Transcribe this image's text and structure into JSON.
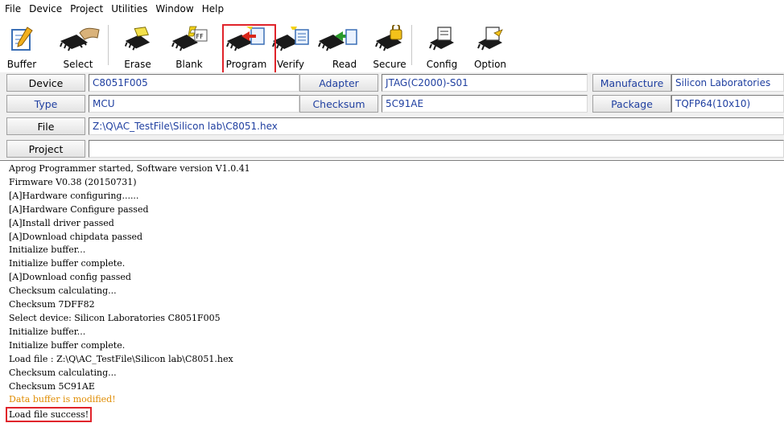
{
  "menu": [
    "File",
    "Device",
    "Project",
    "Utilities",
    "Window",
    "Help"
  ],
  "toolbar": {
    "buttons": [
      {
        "label": "Buffer",
        "icon": "notepad-pencil-icon"
      },
      {
        "label": "Select",
        "icon": "chip-hand-icon"
      },
      {
        "label": "Erase",
        "icon": "chip-eraser-icon"
      },
      {
        "label": "Blank",
        "icon": "chip-ff-icon"
      },
      {
        "label": "Program",
        "icon": "chip-program-icon"
      },
      {
        "label": "Verify",
        "icon": "chip-verify-icon"
      },
      {
        "label": "Read",
        "icon": "chip-read-icon"
      },
      {
        "label": "Secure",
        "icon": "chip-lock-icon"
      },
      {
        "label": "Config",
        "icon": "chip-config-icon"
      },
      {
        "label": "Option",
        "icon": "chip-option-icon"
      }
    ],
    "highlighted": "Program"
  },
  "info": {
    "device_label": "Device",
    "device_value": "C8051F005",
    "adapter_label": "Adapter",
    "adapter_value": "JTAG(C2000)-S01",
    "manufacture_label": "Manufacture",
    "manufacture_value": "Silicon Laboratories",
    "type_label": "Type",
    "type_value": "MCU",
    "checksum_label": "Checksum",
    "checksum_value": "5C91AE",
    "package_label": "Package",
    "package_value": "TQFP64(10x10)",
    "file_label": "File",
    "file_value": "Z:\\Q\\AC_TestFile\\Silicon lab\\C8051.hex",
    "project_label": "Project",
    "project_value": ""
  },
  "log": [
    {
      "text": "Aprog Programmer started, Software version V1.0.41"
    },
    {
      "text": "Firmware V0.38 (20150731)"
    },
    {
      "text": "[A]Hardware configuring......"
    },
    {
      "text": "[A]Hardware Configure passed"
    },
    {
      "text": "[A]Install driver passed"
    },
    {
      "text": "[A]Download chipdata passed"
    },
    {
      "text": "Initialize buffer..."
    },
    {
      "text": "Initialize buffer complete."
    },
    {
      "text": "[A]Download config passed"
    },
    {
      "text": "Checksum calculating..."
    },
    {
      "text": "Checksum 7DFF82"
    },
    {
      "text": "Select device: Silicon Laboratories C8051F005"
    },
    {
      "text": "Initialize buffer..."
    },
    {
      "text": "Initialize buffer complete."
    },
    {
      "text": "Load file : Z:\\Q\\AC_TestFile\\Silicon lab\\C8051.hex"
    },
    {
      "text": "Checksum calculating..."
    },
    {
      "text": "Checksum 5C91AE"
    },
    {
      "text": "Data buffer is modified!",
      "color": "#e08c00"
    },
    {
      "text": "Load file success!",
      "boxed": true
    }
  ],
  "colors": {
    "highlight": "#e0232a",
    "value_text": "#1f3fa0",
    "warning": "#e08c00"
  }
}
